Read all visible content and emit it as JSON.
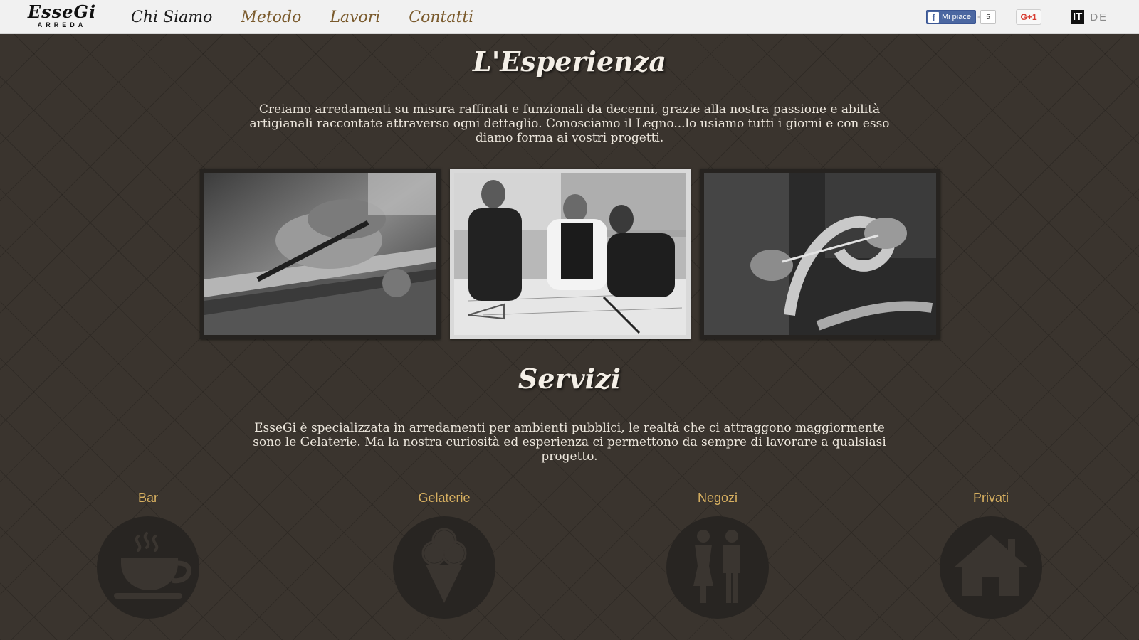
{
  "header": {
    "logo_main": "EsseGi",
    "logo_sub": "ARREDA",
    "nav": [
      {
        "label": "Chi Siamo"
      },
      {
        "label": "Metodo"
      },
      {
        "label": "Lavori"
      },
      {
        "label": "Contatti"
      }
    ],
    "facebook": {
      "label": "Mi piace",
      "count": "5"
    },
    "gplus": {
      "label": "G+1"
    },
    "languages": {
      "current": "IT",
      "other": "DE"
    }
  },
  "esperienza": {
    "title": "L'Esperienza",
    "text": "Creiamo arredamenti su misura raffinati e funzionali da decenni, grazie alla nostra passione e abilità artigianali raccontate attraverso ogni dettaglio. Conosciamo il Legno...lo usiamo tutti i giorni e con esso diamo forma ai vostri progetti."
  },
  "servizi": {
    "title": "Servizi",
    "text": "EsseGi è specializzata in arredamenti per ambienti pubblici, le realtà che ci attraggono maggiormente sono le Gelaterie. Ma la nostra curiosità ed esperienza ci permettono da sempre di lavorare a qualsiasi progetto.",
    "items": [
      {
        "label": "Bar",
        "icon": "coffee-cup-icon"
      },
      {
        "label": "Gelaterie",
        "icon": "ice-cream-icon"
      },
      {
        "label": "Negozi",
        "icon": "people-icon"
      },
      {
        "label": "Privati",
        "icon": "house-icon"
      }
    ]
  },
  "colors": {
    "background": "#3a342e",
    "topbar": "#f1f1f1",
    "nav_link": "#7a5a2c",
    "nav_active": "#1c1c1c",
    "service_label": "#d8b060",
    "service_circle": "#282522"
  }
}
